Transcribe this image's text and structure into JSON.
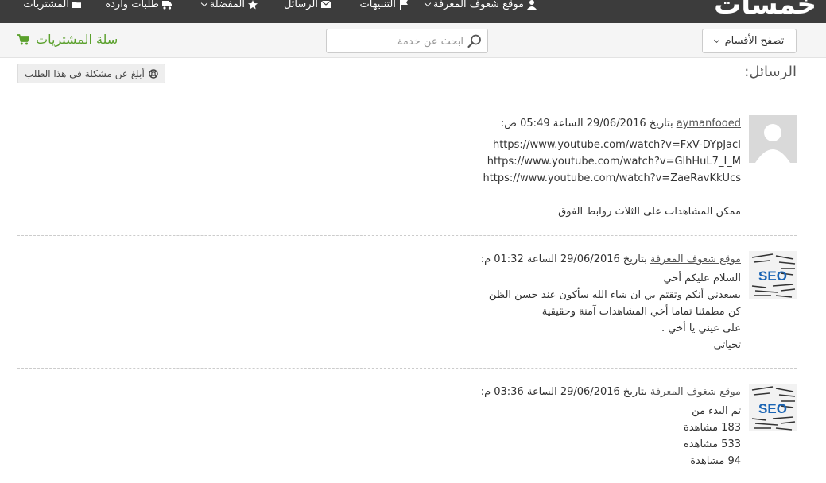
{
  "nav": {
    "logo": "خمسات",
    "items": [
      {
        "label": "موقع شغوف المعرفة",
        "icon": "user-icon",
        "dropdown": true
      },
      {
        "label": "التنبيهات",
        "icon": "flag-icon"
      },
      {
        "label": "الرسائل",
        "icon": "envelope-icon"
      },
      {
        "label": "المفضلة",
        "icon": "star-icon",
        "dropdown": true
      },
      {
        "label": "طلبات واردة",
        "icon": "truck-icon"
      },
      {
        "label": "المشتريات",
        "icon": "folder-open-icon"
      }
    ]
  },
  "subbar": {
    "browse_label": "تصفح الأقسام",
    "search_placeholder": "ابحث عن خدمة",
    "cart_label": "سلة المشتريات"
  },
  "page": {
    "title": "الرسائل:",
    "report_label": "أبلغ عن مشكلة في هذا الطلب"
  },
  "messages": [
    {
      "author": "aymanfooed",
      "meta": " بتاريخ 29/06/2016 الساعة 05:49 ص:",
      "avatar": "default",
      "lines": [
        "https://www.youtube.com/watch?v=FxV-DYpJacI",
        "https://www.youtube.com/watch?v=GlhHuL7_I_M",
        "https://www.youtube.com/watch?v=ZaeRavKkUcs",
        "",
        "ممكن المشاهدات على الثلاث روابط الفوق"
      ]
    },
    {
      "author": "موقع شغوف المعرفة",
      "meta": " بتاريخ 29/06/2016 الساعة 01:32 م:",
      "avatar": "seo",
      "avatar_text": "SEO",
      "lines": [
        "السلام عليكم أخي",
        "يسعدني أنكم وثقتم بي ان شاء الله سأكون عند حسن الظن",
        "كن مطمئنا تماما أخي المشاهدات آمنة وحقيقية",
        "على عيني يا أخي .",
        "تحياتي"
      ]
    },
    {
      "author": "موقع شغوف المعرفة",
      "meta": " بتاريخ 29/06/2016 الساعة 03:36 م:",
      "avatar": "seo",
      "avatar_text": "SEO",
      "lines": [
        "تم البدء من",
        "183 مشاهدة",
        "533 مشاهدة",
        "94 مشاهدة"
      ]
    }
  ],
  "colors": {
    "nav_bg": "#3c3c3c",
    "cart_green": "#5aa02c",
    "seo_blue": "#1a64b4"
  }
}
